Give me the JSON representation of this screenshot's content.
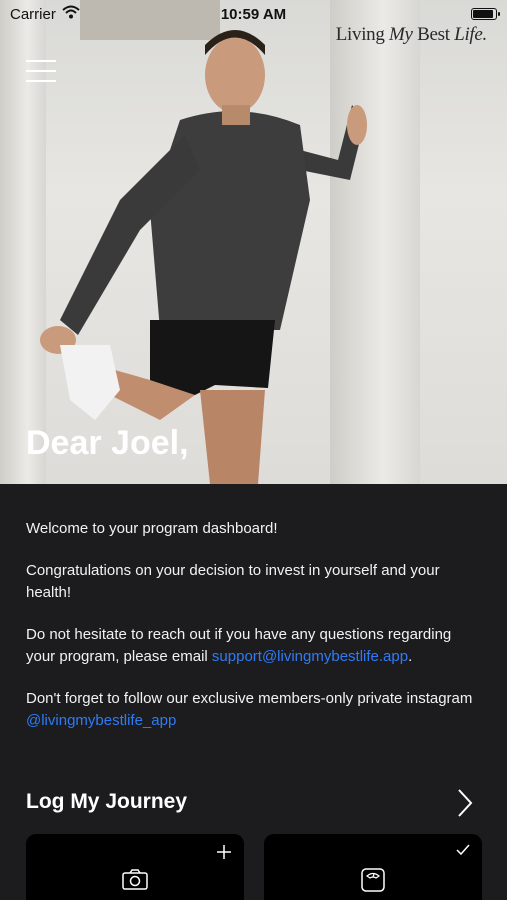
{
  "status_bar": {
    "carrier": "Carrier",
    "time": "10:59 AM"
  },
  "brand": {
    "part1": "Living ",
    "part2": "My",
    "part3": " Best ",
    "part4": "Life."
  },
  "hero": {
    "greeting": "Dear Joel,"
  },
  "content": {
    "p1": "Welcome to your program dashboard!",
    "p2": "Congratulations on your decision to invest in yourself and your health!",
    "p3_prefix": "Do not hesitate to reach out if you have any questions regarding your program, please email ",
    "p3_email": "support@livingmybestlife.app",
    "p3_suffix": ".",
    "p4_prefix": "Don't forget to follow our exclusive members-only private instagram ",
    "p4_handle": "@livingmybestlife_app"
  },
  "section": {
    "title": "Log My Journey"
  },
  "cards": [
    {
      "icon": "camera-icon",
      "corner": "plus-icon"
    },
    {
      "icon": "scale-icon",
      "corner": "check-icon"
    }
  ],
  "colors": {
    "background": "#1c1c1e",
    "card": "#000000",
    "link": "#2f7bf5"
  }
}
